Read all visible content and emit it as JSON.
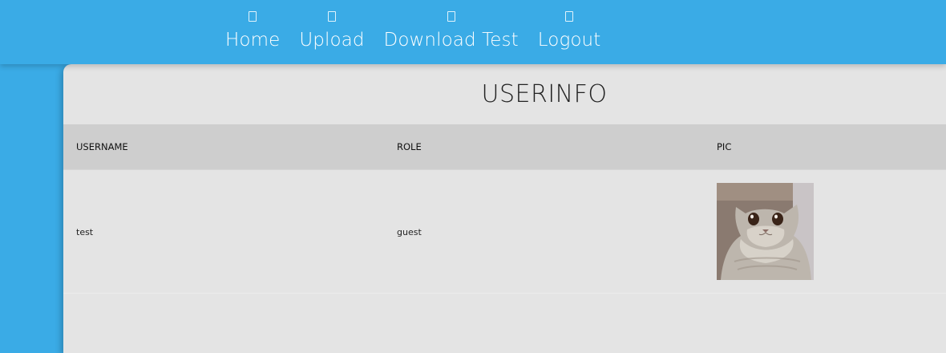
{
  "nav": {
    "items": [
      {
        "label": "Home",
        "icon": "home-icon"
      },
      {
        "label": "Upload",
        "icon": "upload-icon"
      },
      {
        "label": "Download Test",
        "icon": "download-icon"
      },
      {
        "label": "Logout",
        "icon": "logout-icon"
      }
    ]
  },
  "panel": {
    "title": "USERINFO"
  },
  "table": {
    "headers": [
      "USERNAME",
      "ROLE",
      "PIC"
    ],
    "rows": [
      {
        "username": "test",
        "role": "guest",
        "pic": "cat-avatar"
      }
    ]
  },
  "colors": {
    "background": "#3aabe6",
    "panel": "#e4e4e4",
    "table_header": "#cecece"
  }
}
